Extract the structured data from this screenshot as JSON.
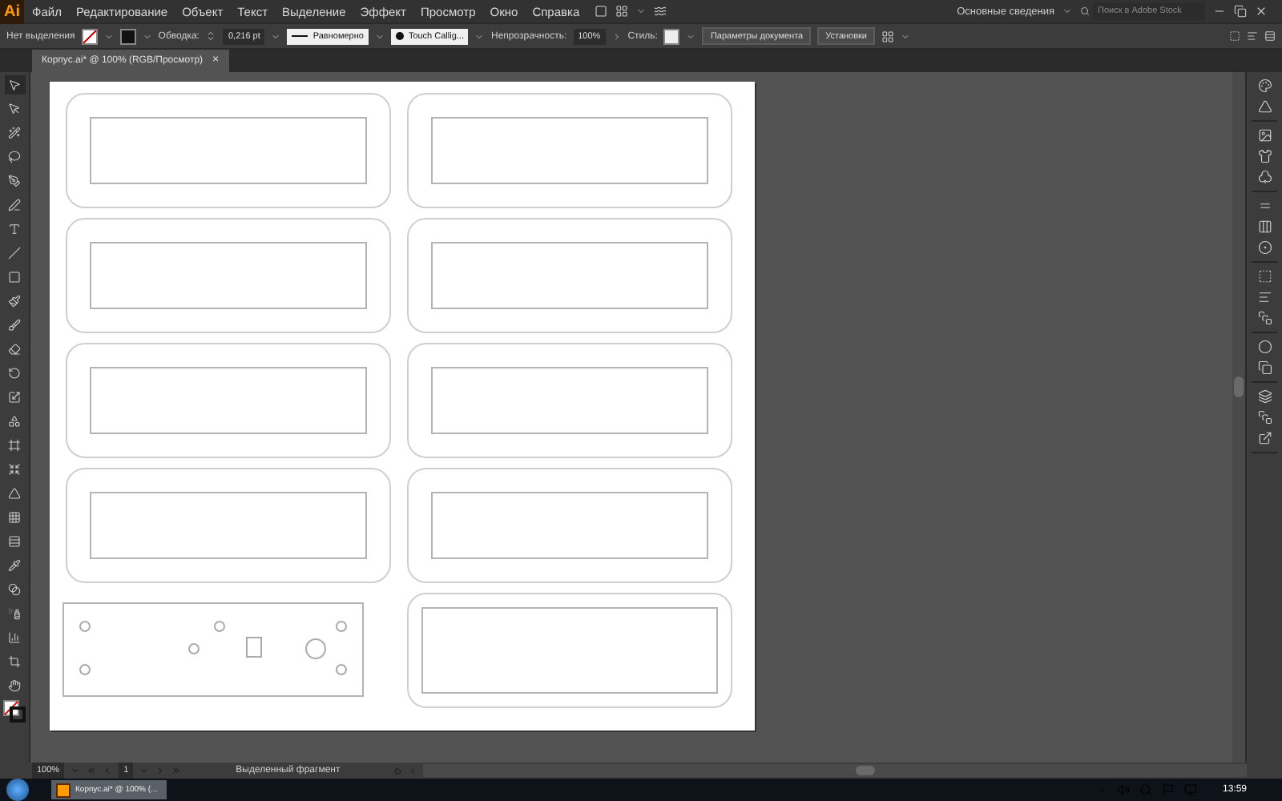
{
  "app_logo": "Ai",
  "menu": [
    "Файл",
    "Редактирование",
    "Объект",
    "Текст",
    "Выделение",
    "Эффект",
    "Просмотр",
    "Окно",
    "Справка"
  ],
  "workspace": "Основные сведения",
  "stock_search": {
    "placeholder": "Поиск в Adobe Stock"
  },
  "control_bar": {
    "selection": "Нет выделения",
    "stroke_label": "Обводка:",
    "stroke_weight": "0,216 pt",
    "stroke_profile": "Равномерно",
    "brush": "Touch Callig...",
    "opacity_label": "Непрозрачность:",
    "opacity": "100%",
    "style_label": "Стиль:",
    "doc_settings": "Параметры документа",
    "preferences": "Установки"
  },
  "document_tab": {
    "title": "Корпус.ai* @ 100% (RGB/Просмотр)",
    "close": "×"
  },
  "tools": [
    {
      "selected": true
    },
    {
      "selected": false
    },
    {
      "selected": false
    },
    {
      "selected": false
    },
    {
      "selected": false
    },
    {
      "selected": false
    },
    {
      "selected": false
    },
    {
      "selected": false
    },
    {
      "selected": false
    },
    {
      "selected": false
    },
    {
      "selected": false
    },
    {
      "selected": false
    },
    {
      "selected": false
    },
    {
      "selected": false
    },
    {
      "selected": false
    },
    {
      "selected": false
    },
    {
      "selected": false
    },
    {
      "selected": false
    },
    {
      "selected": false
    },
    {
      "selected": false
    },
    {
      "selected": false
    },
    {
      "selected": false
    },
    {
      "selected": false
    },
    {
      "selected": false
    },
    {
      "selected": false
    },
    {
      "selected": false
    }
  ],
  "status_bar": {
    "zoom": "100%",
    "artboard": "1",
    "info": "Выделенный фрагмент"
  },
  "taskbar": {
    "items": [
      {
        "title": "Корпус.ai* @ 100% (...",
        "selected": true
      }
    ],
    "clock": "13:59"
  }
}
